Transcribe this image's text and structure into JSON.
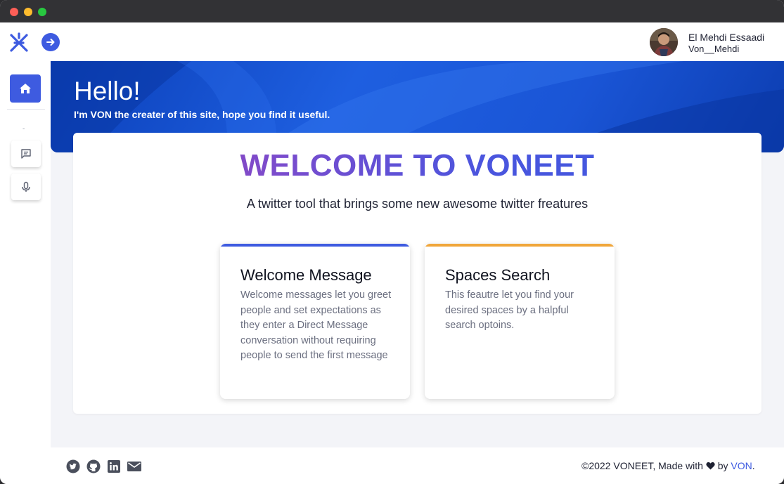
{
  "header": {
    "logo_icon": "voneet-logo-icon",
    "toggle_icon": "arrow-right-icon",
    "user": {
      "name": "El Mehdi Essaadi",
      "handle": "Von__Mehdi",
      "avatar_icon": "user-avatar"
    }
  },
  "sidebar": {
    "items": [
      {
        "icon": "home-icon",
        "active": true
      },
      {
        "icon": "message-icon",
        "active": false
      },
      {
        "icon": "microphone-icon",
        "active": false
      }
    ],
    "dash": "-"
  },
  "hero": {
    "title": "Hello!",
    "subtitle": "I'm VON the creater of this site, hope you find it useful."
  },
  "main": {
    "heading": "WELCOME TO VONEET",
    "tagline": "A twitter tool that brings some new awesome twitter freatures",
    "features": [
      {
        "title": "Welcome Message",
        "description": "Welcome messages let you greet people and set expectations as they enter a Direct Message conversation without requiring people to send the first message",
        "accent": "#3e5be0"
      },
      {
        "title": "Spaces Search",
        "description": "This feautre let you find your desired spaces by a halpful search optoins.",
        "accent": "#f0a63a"
      }
    ]
  },
  "footer": {
    "social_icons": [
      "twitter-icon",
      "github-icon",
      "linkedin-icon",
      "mail-icon"
    ],
    "copyright_prefix": "©2022 VONEET, Made with",
    "heart_icon": "heart-icon",
    "by_text": "by",
    "author": "VON",
    "suffix": "."
  },
  "colors": {
    "accent": "#3e5be0",
    "hero_blue": "#1e5fe0",
    "feature_orange": "#f0a63a"
  }
}
